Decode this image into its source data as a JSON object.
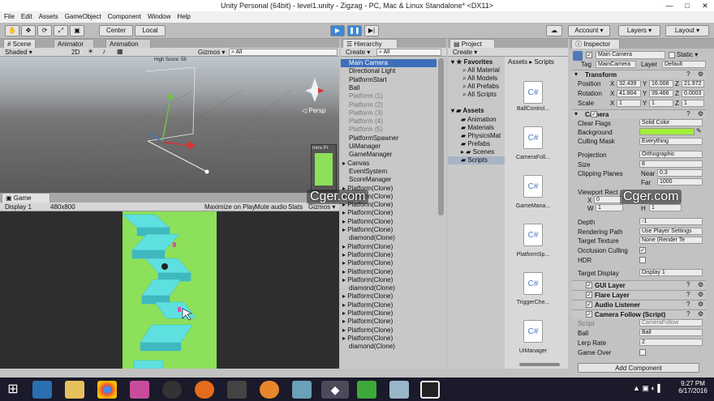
{
  "window": {
    "title": "Unity Personal (64bit) - level1.unity - Zigzag - PC, Mac & Linux Standalone* <DX11>",
    "minimize": "—",
    "maximize": "□",
    "close": "✕"
  },
  "menu": [
    "File",
    "Edit",
    "Assets",
    "GameObject",
    "Component",
    "Window",
    "Help"
  ],
  "toolbar": {
    "center": "Center",
    "local": "Local",
    "account": "Account ▾",
    "layers": "Layers ▾",
    "layout": "Layout ▾"
  },
  "tabs": {
    "scene": "Scene",
    "animator": "Animator",
    "animation": "Animation",
    "game": "Game",
    "hierarchy": "Hierarchy",
    "project": "Project",
    "inspector": "Inspector"
  },
  "scene": {
    "shaded": "Shaded ▾",
    "mode2d": "2D",
    "gizmos": "Gizmos ▾",
    "search": "All",
    "persp": "Persp",
    "high_score": "High Score: 58",
    "preview": "nera Pr"
  },
  "game": {
    "display": "Display 1",
    "resolution": "480x800",
    "maximize": "Maximize on Play",
    "mute": "Mute audio",
    "stats": "Stats",
    "gizmos": "Gizmos ▾"
  },
  "hierarchy": {
    "create": "Create ▾",
    "search": "All",
    "items": [
      {
        "label": "Main Camera",
        "state": "selected"
      },
      {
        "label": "Directional Light",
        "state": "normal"
      },
      {
        "label": "PlatformStart",
        "state": "normal"
      },
      {
        "label": "Ball",
        "state": "normal"
      },
      {
        "label": "Platform (1)",
        "state": "grey"
      },
      {
        "label": "Platform (2)",
        "state": "grey"
      },
      {
        "label": "Platform (3)",
        "state": "grey"
      },
      {
        "label": "Platform (4)",
        "state": "grey"
      },
      {
        "label": "Platform (5)",
        "state": "grey"
      },
      {
        "label": "PlatformSpawner",
        "state": "normal"
      },
      {
        "label": "UiManager",
        "state": "normal"
      },
      {
        "label": "GameManager",
        "state": "normal"
      },
      {
        "label": "Canvas",
        "state": "expand"
      },
      {
        "label": "EventSystem",
        "state": "normal"
      },
      {
        "label": "ScoreManager",
        "state": "normal"
      },
      {
        "label": "Platform(Clone)",
        "state": "expand"
      },
      {
        "label": "Platform(Clone)",
        "state": "expand"
      },
      {
        "label": "Platform(Clone)",
        "state": "expand"
      },
      {
        "label": "Platform(Clone)",
        "state": "expand"
      },
      {
        "label": "Platform(Clone)",
        "state": "expand"
      },
      {
        "label": "Platform(Clone)",
        "state": "expand"
      },
      {
        "label": "diamond(Clone)",
        "state": "normal"
      },
      {
        "label": "Platform(Clone)",
        "state": "expand"
      },
      {
        "label": "Platform(Clone)",
        "state": "expand"
      },
      {
        "label": "Platform(Clone)",
        "state": "expand"
      },
      {
        "label": "Platform(Clone)",
        "state": "expand"
      },
      {
        "label": "Platform(Clone)",
        "state": "expand"
      },
      {
        "label": "diamond(Clone)",
        "state": "normal"
      },
      {
        "label": "Platform(Clone)",
        "state": "expand"
      },
      {
        "label": "Platform(Clone)",
        "state": "expand"
      },
      {
        "label": "Platform(Clone)",
        "state": "expand"
      },
      {
        "label": "Platform(Clone)",
        "state": "expand"
      },
      {
        "label": "Platform(Clone)",
        "state": "expand"
      },
      {
        "label": "Platform(Clone)",
        "state": "expand"
      },
      {
        "label": "diamond(Clone)",
        "state": "normal"
      }
    ]
  },
  "project": {
    "create": "Create ▾",
    "breadcrumb": "Assets ▸ Scripts",
    "favorites": "Favorites",
    "fav_items": [
      "All Material",
      "All Models",
      "All Prefabs",
      "All Scripts"
    ],
    "assets": "Assets",
    "folders": [
      "Animation",
      "Materials",
      "PhysicsMat",
      "Prefabs",
      "Scenes",
      "Scripts"
    ],
    "scripts": [
      "BallControl...",
      "CameraFoll...",
      "GameMana...",
      "PlatformSp...",
      "TriggerChe...",
      "UiManager"
    ]
  },
  "inspector": {
    "name": "Main Camera",
    "static": "Static ▾",
    "tag_label": "Tag",
    "tag": "MainCamera",
    "layer_label": "Layer",
    "layer": "Default",
    "transform": "Transform",
    "position": {
      "label": "Position",
      "x": "32.439",
      "y": "16.008",
      "z": "21.972"
    },
    "rotation": {
      "label": "Rotation",
      "x": "41.804",
      "y": "39.466",
      "z": "0.0003"
    },
    "scale": {
      "label": "Scale",
      "x": "1",
      "y": "1",
      "z": "1"
    },
    "camera": "Camera",
    "clear_flags": {
      "label": "Clear Flags",
      "value": "Solid Color"
    },
    "background": {
      "label": "Background",
      "color": "#a3ed3a"
    },
    "culling": {
      "label": "Culling Mask",
      "value": "Everything"
    },
    "projection": {
      "label": "Projection",
      "value": "Orthographic"
    },
    "size": {
      "label": "Size",
      "value": "8"
    },
    "clipping": {
      "label": "Clipping Planes",
      "near_label": "Near",
      "near": "0.3",
      "far_label": "Far",
      "far": "1000"
    },
    "viewport": {
      "label": "Viewport Rect",
      "x": "0",
      "w": "1",
      "h": "1"
    },
    "depth": {
      "label": "Depth",
      "value": "-1"
    },
    "rendering": {
      "label": "Rendering Path",
      "value": "Use Player Settings"
    },
    "target_texture": {
      "label": "Target Texture",
      "value": "None (Render Te"
    },
    "occlusion": {
      "label": "Occlusion Culling"
    },
    "hdr": {
      "label": "HDR"
    },
    "target_display": {
      "label": "Target Display",
      "value": "Display 1"
    },
    "gui_layer": "GUI Layer",
    "flare_layer": "Flare Layer",
    "audio_listener": "Audio Listener",
    "camera_follow": "Camera Follow (Script)",
    "script": {
      "label": "Script",
      "value": "CameraFollow"
    },
    "ball": {
      "label": "Ball",
      "value": "Ball"
    },
    "lerp": {
      "label": "Lerp Rate",
      "value": "2"
    },
    "game_over": {
      "label": "Game Over"
    },
    "add_component": "Add Component"
  },
  "watermark": "Cger.com",
  "taskbar": {
    "time": "9:27 PM",
    "date": "6/17/2016"
  },
  "colors": {
    "platform": "#5ee0e0",
    "game_bg": "#8de05a",
    "selection": "#3d6fb8"
  }
}
